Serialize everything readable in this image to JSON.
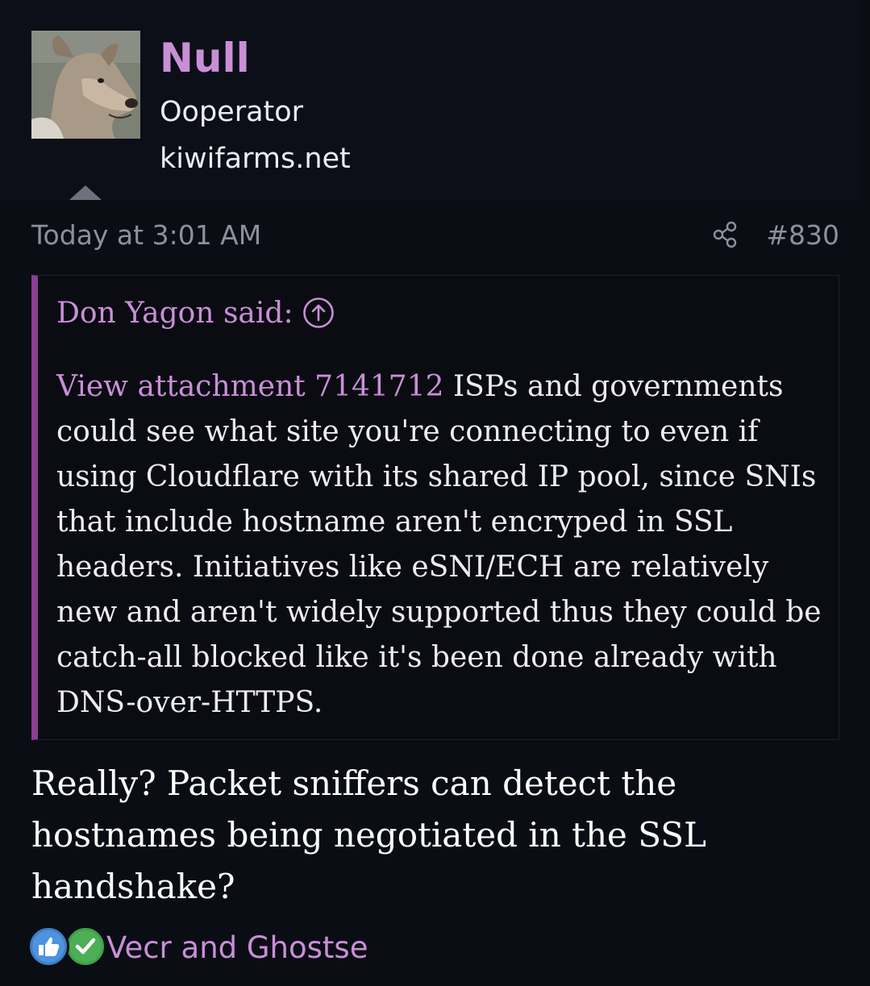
{
  "author": {
    "name": "Null",
    "title": "Ooperator",
    "site": "kiwifarms.net"
  },
  "post": {
    "date": "Today at 3:01 AM",
    "number": "#830",
    "share_icon": "share-icon"
  },
  "quote": {
    "author": "Don Yagon said:",
    "attachment_link": "View attachment 7141712",
    "text": " ISPs and governments could see what site you're connecting to even if using Cloudflare with its shared IP pool, since SNIs that include hostname aren't encryped in SSL headers. Initiatives like eSNI/ECH are relatively new and aren't widely supported thus they could be catch-all blocked like it's been done already with DNS-over-HTTPS."
  },
  "message": "Really? Packet sniffers can detect the hostnames being negotiated in the SSL handshake?",
  "reactions": {
    "icons": [
      "like-icon",
      "agree-icon"
    ],
    "names": "Vecr and Ghostse"
  },
  "colors": {
    "background": "#0b0d14",
    "accent": "#c98fd6",
    "quote_border": "#8c3f94",
    "muted": "#8d909c"
  }
}
